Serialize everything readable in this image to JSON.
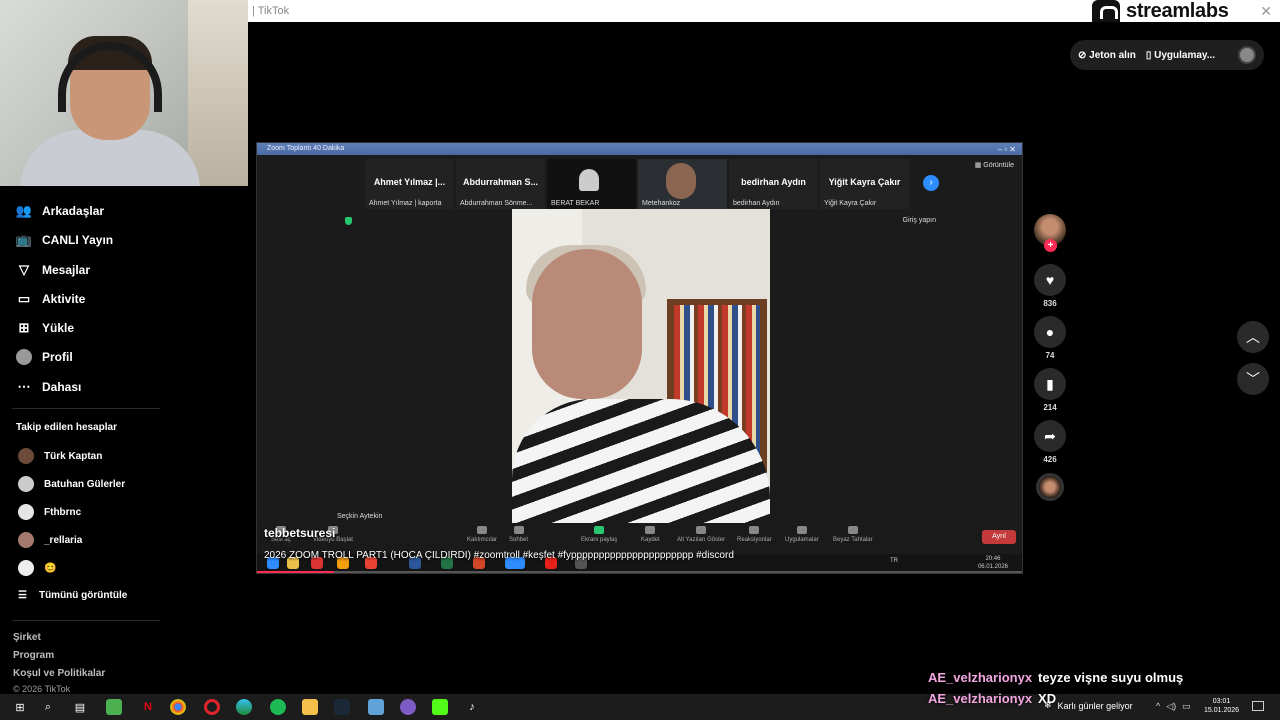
{
  "browser": {
    "tab_title": "| TikTok",
    "overlay_brand": "streamlabs"
  },
  "sidebar": {
    "nav": [
      {
        "icon": "friends-icon",
        "label": "Arkadaşlar"
      },
      {
        "icon": "live-tv-icon",
        "label": "CANLI Yayın"
      },
      {
        "icon": "messages-icon",
        "label": "Mesajlar"
      },
      {
        "icon": "activity-icon",
        "label": "Aktivite"
      },
      {
        "icon": "upload-icon",
        "label": "Yükle"
      },
      {
        "icon": "profile-icon",
        "label": "Profil"
      },
      {
        "icon": "more-icon",
        "label": "Dahası"
      }
    ],
    "following_title": "Takip edilen hesaplar",
    "following": [
      {
        "name": "Türk Kaptan"
      },
      {
        "name": "Batuhan Gülerler"
      },
      {
        "name": "Fthbrnc"
      },
      {
        "name": "_rellaria"
      },
      {
        "name": "😊"
      }
    ],
    "see_all": "Tümünü görüntüle",
    "footer": [
      "Şirket",
      "Program",
      "Koşul ve Politikalar"
    ],
    "copyright": "© 2026 TikTok"
  },
  "topbar": {
    "coins": "Jeton alın",
    "app": "Uygulamay..."
  },
  "video": {
    "zoom_title": "Zoom Toplantı 40 Dakika",
    "gallery_label": "Görüntüle",
    "participants": [
      {
        "name": "Ahmet Yılmaz |...",
        "caption": "Ahmet Yılmaz | kaporta"
      },
      {
        "name": "Abdurrahman S...",
        "caption": "Abdurrahman Sönme..."
      },
      {
        "name": "",
        "caption": "BERAT BEKAR"
      },
      {
        "name": "",
        "caption": "Metehankoz"
      },
      {
        "name": "bedirhan Aydın",
        "caption": "bedirhan Aydın"
      },
      {
        "name": "Yiğit Kayra Çakır",
        "caption": "Yiğit Kayra Çakır"
      }
    ],
    "login_label": "Giriş yapın",
    "active_speaker": "Seçkin Aytekin",
    "toolbar": [
      "Sesi aç",
      "Videoyu Başlat",
      "Katılımcılar",
      "Sohbet",
      "Ekranı paylaş",
      "Kaydet",
      "Alt Yazıları Göster",
      "Reaksiyonlar",
      "Uygulamalar",
      "Beyaz Tahtalar"
    ],
    "leave_label": "Ayrıl",
    "inner_time": "20:46",
    "inner_date": "06.01.2026",
    "inner_lang": "TR",
    "progress": 0.1,
    "author": "tebbetsuresi",
    "description": "2026 ZOOM TROLL PART1 (HOCA ÇILDIRDI) #zoomtroll #keşfet #fypppppppppppppppppppppp #discord"
  },
  "actions": {
    "likes": "836",
    "comments": "74",
    "saves": "214",
    "shares": "426"
  },
  "chat": [
    {
      "user": "AE_velzharionyx",
      "msg": "teyze vişne suyu olmuş"
    },
    {
      "user": "AE_velzharionyx",
      "msg": "XD"
    }
  ],
  "taskbar": {
    "weather": "Karlı günler geliyor",
    "time": "03:01",
    "date": "15.01.2026"
  }
}
